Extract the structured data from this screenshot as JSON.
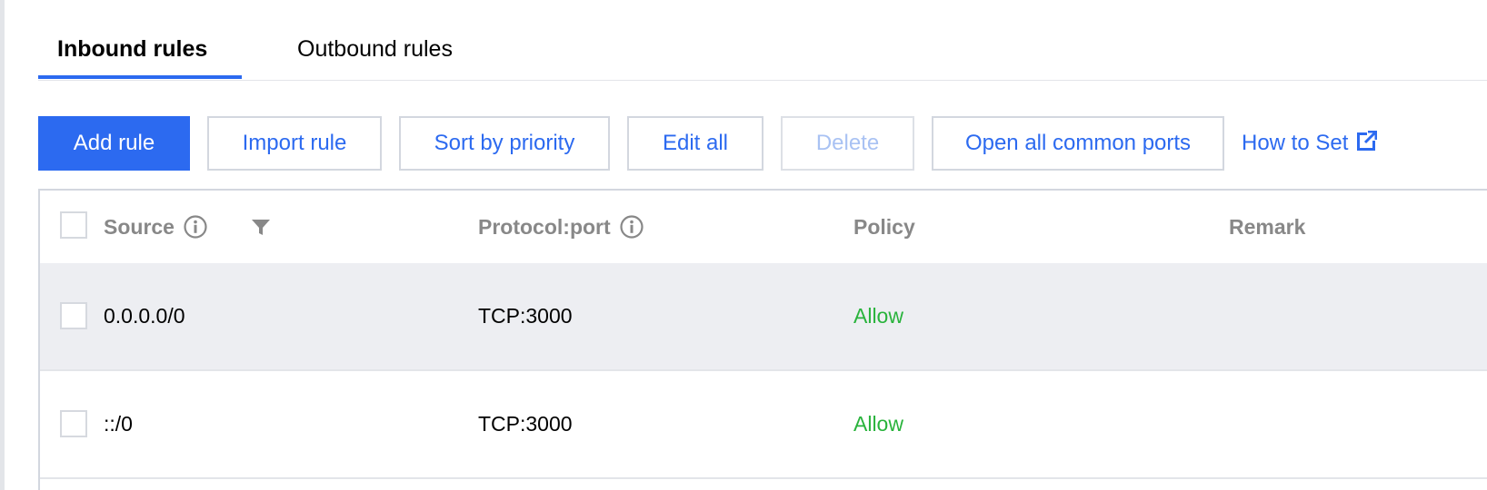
{
  "tabs": [
    {
      "label": "Inbound rules",
      "active": true
    },
    {
      "label": "Outbound rules",
      "active": false
    }
  ],
  "toolbar": {
    "add_rule": "Add rule",
    "import_rule": "Import rule",
    "sort_by_priority": "Sort by priority",
    "edit_all": "Edit all",
    "delete": "Delete",
    "open_common_ports": "Open all common ports",
    "how_to_set": "How to Set"
  },
  "table": {
    "columns": {
      "source": "Source",
      "protocol_port": "Protocol:port",
      "policy": "Policy",
      "remark": "Remark"
    },
    "rows": [
      {
        "source": "0.0.0.0/0",
        "protocol_port": "TCP:3000",
        "policy": "Allow",
        "remark": ""
      },
      {
        "source": "::/0",
        "protocol_port": "TCP:3000",
        "policy": "Allow",
        "remark": ""
      }
    ]
  },
  "colors": {
    "accent": "#2c6af0",
    "allow": "#29b33c",
    "row_highlight": "#edeef2",
    "header_text": "#888888"
  },
  "icons": {
    "info": "info-circle-icon",
    "filter": "filter-funnel-icon",
    "external_link": "external-link-icon"
  }
}
